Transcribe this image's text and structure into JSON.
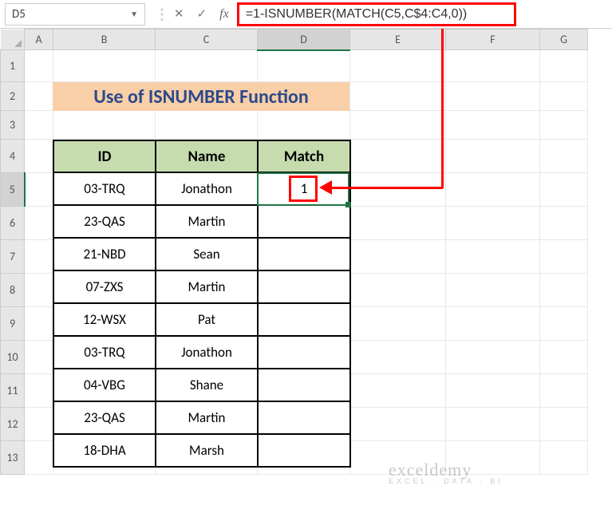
{
  "nameBox": "D5",
  "formula": "=1-ISNUMBER(MATCH(C5,C$4:C4,0))",
  "columns": [
    "A",
    "B",
    "C",
    "D",
    "E",
    "F",
    "G"
  ],
  "rows": [
    "1",
    "2",
    "3",
    "4",
    "5",
    "6",
    "7",
    "8",
    "9",
    "10",
    "11",
    "12",
    "13"
  ],
  "title": "Use of ISNUMBER Function",
  "headers": {
    "id": "ID",
    "name": "Name",
    "match": "Match"
  },
  "data": [
    {
      "id": "03-TRQ",
      "name": "Jonathon",
      "match": "1"
    },
    {
      "id": "23-QAS",
      "name": "Martin",
      "match": ""
    },
    {
      "id": "21-NBD",
      "name": "Sean",
      "match": ""
    },
    {
      "id": "07-ZXS",
      "name": "Martin",
      "match": ""
    },
    {
      "id": "12-WSX",
      "name": "Pat",
      "match": ""
    },
    {
      "id": "03-TRQ",
      "name": "Jonathon",
      "match": ""
    },
    {
      "id": "04-VBG",
      "name": "Shane",
      "match": ""
    },
    {
      "id": "23-QAS",
      "name": "Martin",
      "match": ""
    },
    {
      "id": "18-DHA",
      "name": "Marsh",
      "match": ""
    }
  ],
  "selectedCell": {
    "col": "D",
    "row": 5
  },
  "watermark": {
    "main": "exceldemy",
    "sub": "EXCEL · DATA · BI"
  }
}
